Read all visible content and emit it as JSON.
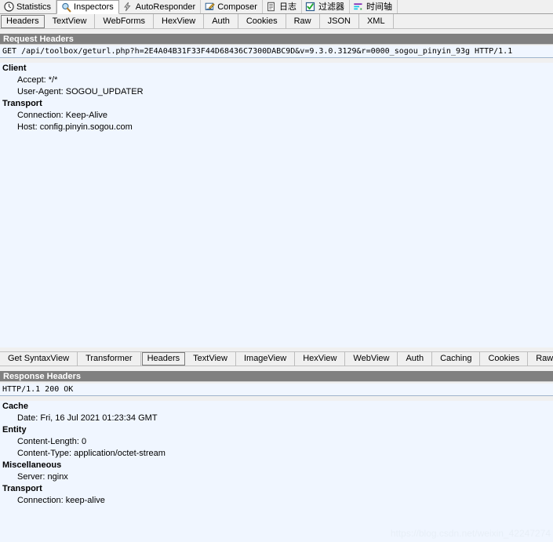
{
  "main_tabs": [
    {
      "label": "Statistics",
      "icon": "statistics-clock-icon",
      "active": false
    },
    {
      "label": "Inspectors",
      "icon": "magnifier-icon",
      "active": true
    },
    {
      "label": "AutoResponder",
      "icon": "lightning-bolt-icon",
      "active": false
    },
    {
      "label": "Composer",
      "icon": "compose-pencil-icon",
      "active": false
    },
    {
      "label": "日志",
      "icon": "log-document-icon",
      "active": false
    },
    {
      "label": "过滤器",
      "icon": "filter-checkbox-icon",
      "active": false
    },
    {
      "label": "时间轴",
      "icon": "timeline-icon",
      "active": false
    }
  ],
  "request": {
    "tabs": [
      {
        "label": "Headers",
        "selected": true
      },
      {
        "label": "TextView",
        "selected": false
      },
      {
        "label": "WebForms",
        "selected": false
      },
      {
        "label": "HexView",
        "selected": false
      },
      {
        "label": "Auth",
        "selected": false
      },
      {
        "label": "Cookies",
        "selected": false
      },
      {
        "label": "Raw",
        "selected": false
      },
      {
        "label": "JSON",
        "selected": false
      },
      {
        "label": "XML",
        "selected": false
      }
    ],
    "section_title": "Request Headers",
    "request_line": "GET /api/toolbox/geturl.php?h=2E4A04B31F33F44D68436C7300DABC9D&v=9.3.0.3129&r=0000_sogou_pinyin_93g HTTP/1.1",
    "groups": [
      {
        "name": "Client",
        "items": [
          "Accept: */*",
          "User-Agent: SOGOU_UPDATER"
        ]
      },
      {
        "name": "Transport",
        "items": [
          "Connection: Keep-Alive",
          "Host: config.pinyin.sogou.com"
        ]
      }
    ]
  },
  "response": {
    "tabs": [
      {
        "label": "Get SyntaxView",
        "selected": false
      },
      {
        "label": "Transformer",
        "selected": false
      },
      {
        "label": "Headers",
        "selected": true
      },
      {
        "label": "TextView",
        "selected": false
      },
      {
        "label": "ImageView",
        "selected": false
      },
      {
        "label": "HexView",
        "selected": false
      },
      {
        "label": "WebView",
        "selected": false
      },
      {
        "label": "Auth",
        "selected": false
      },
      {
        "label": "Caching",
        "selected": false
      },
      {
        "label": "Cookies",
        "selected": false
      },
      {
        "label": "Raw",
        "selected": false
      }
    ],
    "section_title": "Response Headers",
    "status_line": "HTTP/1.1 200 OK",
    "groups": [
      {
        "name": "Cache",
        "items": [
          "Date: Fri, 16 Jul 2021 01:23:34 GMT"
        ]
      },
      {
        "name": "Entity",
        "items": [
          "Content-Length: 0",
          "Content-Type: application/octet-stream"
        ]
      },
      {
        "name": "Miscellaneous",
        "items": [
          "Server: nginx"
        ]
      },
      {
        "name": "Transport",
        "items": [
          "Connection: keep-alive"
        ]
      }
    ]
  },
  "watermark": "https://blog.csdn.net/weixin_42247274",
  "colors": {
    "section_bar": "#808080",
    "pane_background": "#f0f6ff",
    "chrome": "#f0f0f0",
    "watermark": "#e8eff7"
  }
}
